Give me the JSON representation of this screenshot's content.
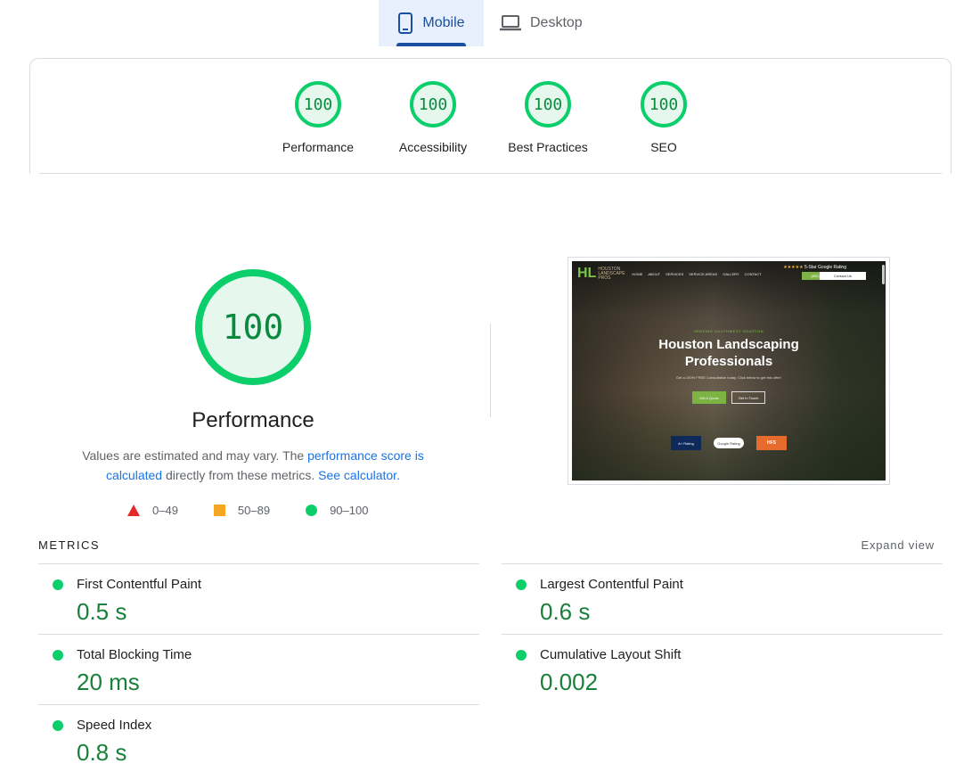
{
  "tabs": [
    {
      "label": "Mobile",
      "icon": "smartphone-icon",
      "active": true
    },
    {
      "label": "Desktop",
      "icon": "laptop-icon",
      "active": false
    }
  ],
  "summary_scores": [
    {
      "score": "100",
      "label": "Performance"
    },
    {
      "score": "100",
      "label": "Accessibility"
    },
    {
      "score": "100",
      "label": "Best Practices"
    },
    {
      "score": "100",
      "label": "SEO"
    }
  ],
  "performance": {
    "score": "100",
    "title": "Performance",
    "desc_part1": "Values are estimated and may vary. The ",
    "desc_link1": "performance score is calculated",
    "desc_part2": " directly from these metrics. ",
    "desc_link2": "See calculator."
  },
  "legend": [
    {
      "shape": "triangle",
      "range": "0–49",
      "color": "#e52a2a"
    },
    {
      "shape": "square",
      "range": "50–89",
      "color": "#f6a623"
    },
    {
      "shape": "circle",
      "range": "90–100",
      "color": "#0cce6b"
    }
  ],
  "screenshot": {
    "logo": "HL",
    "logo_sub": "HOUSTON LANDSCAPE PROS",
    "nav": [
      "HOME",
      "ABOUT",
      "SERVICES",
      "SERVICE AREAS",
      "GALLERY",
      "CONTACT"
    ],
    "rating": "5-Star Google Rating",
    "phone": "(832) 543-8430",
    "contact": "Contact Us",
    "serving": "SERVING SOUTHWEST HOUSTON",
    "hero": "Houston Landscaping Professionals",
    "sub": "Get a 100% FREE Consultation today. Click below to get this offer!",
    "btn1": "Get A Quote",
    "btn2": "Get In Touch",
    "badge1": "A+ Rating",
    "badge2": "Google Rating",
    "badge3": "HFS"
  },
  "metrics": {
    "header": "METRICS",
    "expand": "Expand view",
    "items": [
      {
        "name": "First Contentful Paint",
        "value": "0.5 s",
        "status": "good"
      },
      {
        "name": "Largest Contentful Paint",
        "value": "0.6 s",
        "status": "good"
      },
      {
        "name": "Total Blocking Time",
        "value": "20 ms",
        "status": "good"
      },
      {
        "name": "Cumulative Layout Shift",
        "value": "0.002",
        "status": "good"
      },
      {
        "name": "Speed Index",
        "value": "0.8 s",
        "status": "good"
      }
    ]
  },
  "colors": {
    "pass": "#0cce6b",
    "pass_text": "#188038",
    "accent": "#1a73e8",
    "tab_active": "#1a4fa0"
  }
}
